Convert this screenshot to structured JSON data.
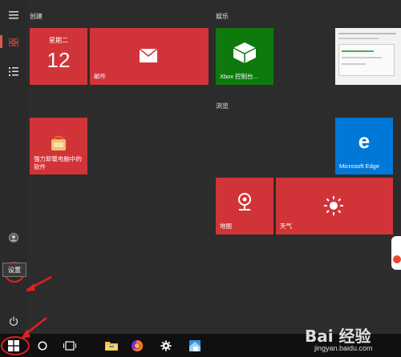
{
  "groups": {
    "create": "创建",
    "entertainment": "娱乐",
    "browse": "浏览"
  },
  "calendar": {
    "weekday": "星期二",
    "day": "12"
  },
  "tiles": {
    "mail": "邮件",
    "xbox": "Xbox 控制台...",
    "app_store": "强力卸载电脑中的软件",
    "edge": "Microsoft Edge",
    "maps": "地图",
    "weather": "天气"
  },
  "tooltip": {
    "settings": "设置"
  },
  "watermark": {
    "brand": "Bai 经验",
    "url": "jingyan.baidu.com"
  },
  "colors": {
    "tile_red": "#d13438",
    "xbox_green": "#0e7a0d",
    "edge_blue": "#0078d7",
    "annotation_red": "#e02020"
  },
  "icons": [
    "hamburger-icon",
    "all-apps-icon",
    "list-icon",
    "user-icon",
    "settings-gear-icon",
    "power-icon",
    "windows-start-icon",
    "cortana-circle-icon",
    "task-view-icon",
    "file-explorer-icon",
    "firefox-icon",
    "taskbar-settings-icon",
    "app-icon",
    "mail-envelope-icon",
    "xbox-console-icon",
    "edge-icon",
    "maps-pin-icon",
    "weather-sun-icon"
  ]
}
